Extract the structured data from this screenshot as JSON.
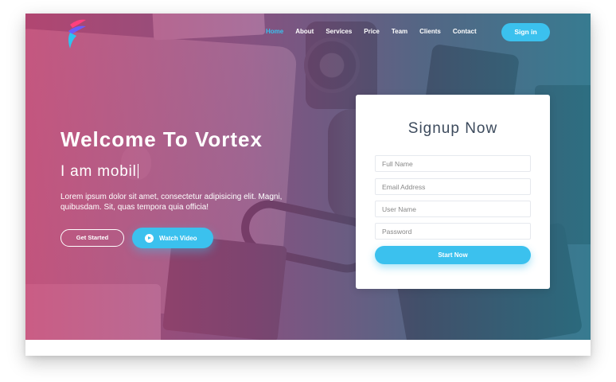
{
  "nav": {
    "items": [
      "Home",
      "About",
      "Services",
      "Price",
      "Team",
      "Clients",
      "Contact"
    ],
    "active_index": 0,
    "signin_label": "Sign in"
  },
  "hero": {
    "title": "Welcome To Vortex",
    "typed_text": "I am mobil",
    "description": "Lorem ipsum dolor sit amet, consectetur adipisicing elit. Magni, quibusdam. Sit, quas tempora quia officia!",
    "get_started_label": "Get Started",
    "watch_video_label": "Watch Video"
  },
  "signup": {
    "title": "Signup Now",
    "full_name_placeholder": "Full Name",
    "email_placeholder": "Email Address",
    "username_placeholder": "User Name",
    "password_placeholder": "Password",
    "submit_label": "Start Now"
  },
  "colors": {
    "accent": "#3bc1ee",
    "overlay_left": "#c43e6e",
    "overlay_right": "#2d8096",
    "card_title": "#3c4a5c"
  },
  "icons": {
    "logo": "vortex-logo",
    "play": "play-icon"
  }
}
